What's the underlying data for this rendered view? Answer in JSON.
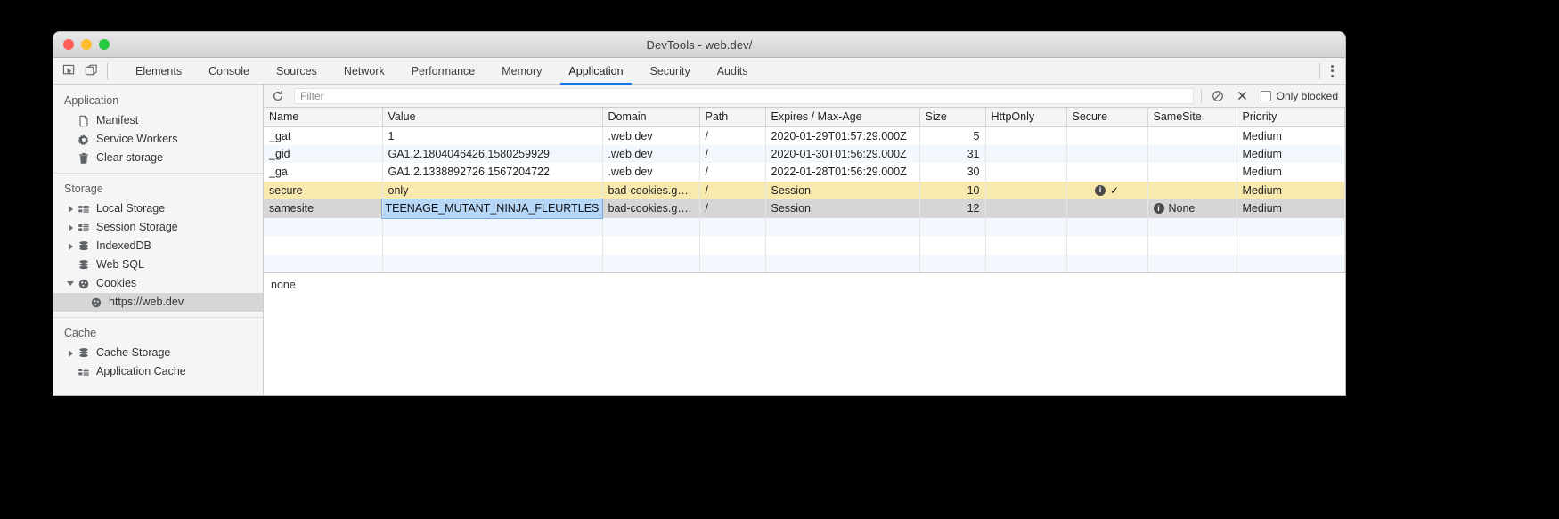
{
  "window": {
    "title": "DevTools - web.dev/",
    "traffic_lights": [
      "close",
      "minimize",
      "zoom"
    ]
  },
  "tabbar": {
    "inspect_icon": "inspect-cursor-icon",
    "device_icon": "device-toolbar-icon",
    "menu_icon": "kebab-menu-icon",
    "tabs": [
      {
        "label": "Elements",
        "active": false
      },
      {
        "label": "Console",
        "active": false
      },
      {
        "label": "Sources",
        "active": false
      },
      {
        "label": "Network",
        "active": false
      },
      {
        "label": "Performance",
        "active": false
      },
      {
        "label": "Memory",
        "active": false
      },
      {
        "label": "Application",
        "active": true
      },
      {
        "label": "Security",
        "active": false
      },
      {
        "label": "Audits",
        "active": false
      }
    ]
  },
  "sidebar": {
    "sections": [
      {
        "title": "Application",
        "items": [
          {
            "label": "Manifest",
            "icon": "document-icon",
            "expand": "none",
            "selected": false
          },
          {
            "label": "Service Workers",
            "icon": "gear-icon",
            "expand": "none",
            "selected": false
          },
          {
            "label": "Clear storage",
            "icon": "trash-icon",
            "expand": "none",
            "selected": false
          }
        ]
      },
      {
        "title": "Storage",
        "items": [
          {
            "label": "Local Storage",
            "icon": "table-icon",
            "expand": "right",
            "selected": false
          },
          {
            "label": "Session Storage",
            "icon": "table-icon",
            "expand": "right",
            "selected": false
          },
          {
            "label": "IndexedDB",
            "icon": "database-icon",
            "expand": "right",
            "selected": false
          },
          {
            "label": "Web SQL",
            "icon": "database-icon",
            "expand": "none",
            "selected": false
          },
          {
            "label": "Cookies",
            "icon": "cookie-icon",
            "expand": "down",
            "selected": false
          },
          {
            "label": "https://web.dev",
            "icon": "cookie-icon",
            "expand": "none",
            "selected": true,
            "sub": true
          }
        ]
      },
      {
        "title": "Cache",
        "items": [
          {
            "label": "Cache Storage",
            "icon": "database-icon",
            "expand": "right",
            "selected": false
          },
          {
            "label": "Application Cache",
            "icon": "table-icon",
            "expand": "none",
            "selected": false
          }
        ]
      }
    ]
  },
  "toolbar": {
    "refresh_icon": "refresh-icon",
    "clear_icon": "block-clear-icon",
    "delete_icon": "delete-x-icon",
    "filter_value": "",
    "filter_placeholder": "Filter",
    "only_blocked_label": "Only blocked",
    "only_blocked_checked": false
  },
  "table": {
    "columns": [
      "Name",
      "Value",
      "Domain",
      "Path",
      "Expires / Max-Age",
      "Size",
      "HttpOnly",
      "Secure",
      "SameSite",
      "Priority"
    ],
    "rows": [
      {
        "name": "_gat",
        "value": "1",
        "domain": ".web.dev",
        "path": "/",
        "expires": "2020-01-29T01:57:29.000Z",
        "size": "5",
        "httponly": "",
        "secure": "",
        "samesite": "",
        "priority": "Medium",
        "state": "odd"
      },
      {
        "name": "_gid",
        "value": "GA1.2.1804046426.1580259929",
        "domain": ".web.dev",
        "path": "/",
        "expires": "2020-01-30T01:56:29.000Z",
        "size": "31",
        "httponly": "",
        "secure": "",
        "samesite": "",
        "priority": "Medium",
        "state": "even"
      },
      {
        "name": "_ga",
        "value": "GA1.2.1338892726.1567204722",
        "domain": ".web.dev",
        "path": "/",
        "expires": "2022-01-28T01:56:29.000Z",
        "size": "30",
        "httponly": "",
        "secure": "",
        "samesite": "",
        "priority": "Medium",
        "state": "odd"
      },
      {
        "name": "secure",
        "value": "only",
        "domain": "bad-cookies.g…",
        "path": "/",
        "expires": "Session",
        "size": "10",
        "httponly": "",
        "secure": "✓",
        "secure_info": "i",
        "samesite": "",
        "priority": "Medium",
        "state": "warn"
      },
      {
        "name": "samesite",
        "value": "TEENAGE_MUTANT_NINJA_FLEURTLES",
        "value_editing": true,
        "domain": "bad-cookies.g…",
        "path": "/",
        "expires": "Session",
        "size": "12",
        "httponly": "",
        "secure": "",
        "samesite": "None",
        "samesite_info": "i",
        "priority": "Medium",
        "state": "sel"
      }
    ]
  },
  "preview": {
    "text": "none"
  },
  "colors": {
    "accent": "#1a73e8",
    "warn_row": "#f8e9ae",
    "selected_row": "#d6d6d6",
    "edit_highlight": "#b6d7f7"
  }
}
